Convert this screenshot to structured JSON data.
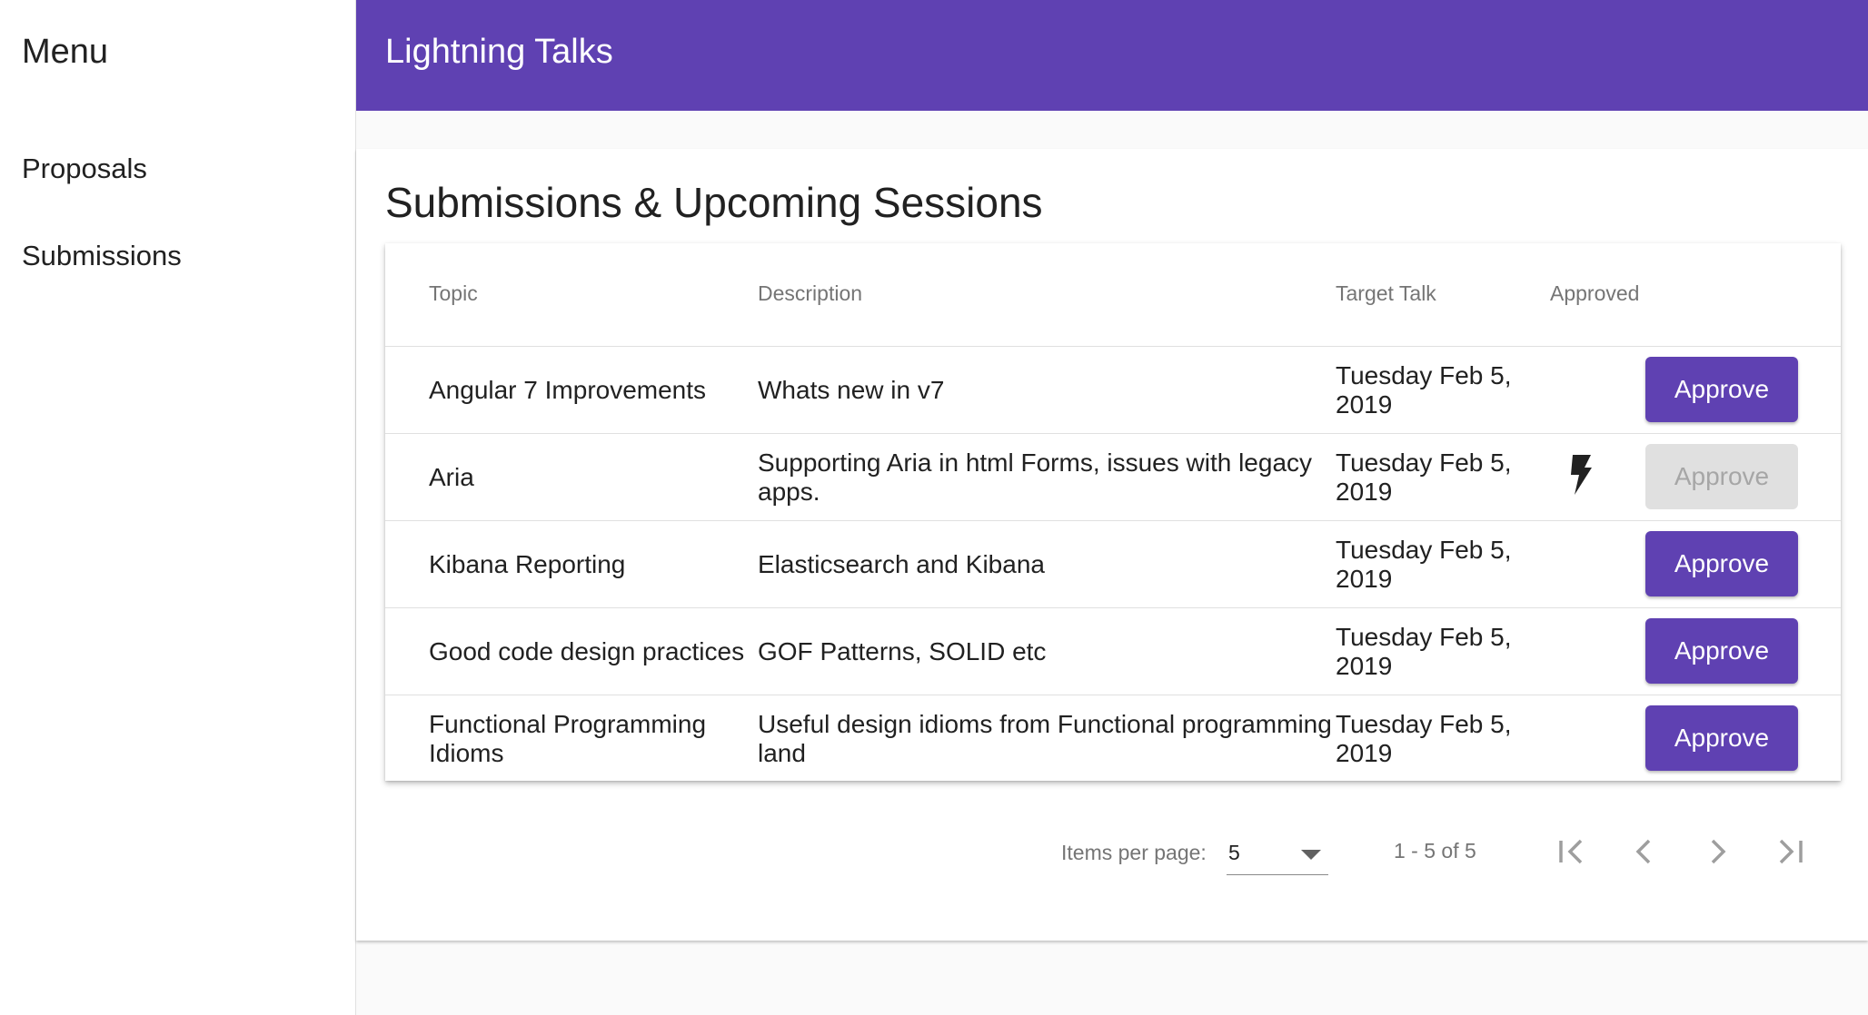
{
  "sidebar": {
    "title": "Menu",
    "items": [
      {
        "label": "Proposals"
      },
      {
        "label": "Submissions"
      }
    ]
  },
  "toolbar": {
    "title": "Lightning Talks"
  },
  "colors": {
    "primary": "#5f41b2",
    "disabled_bg": "#e0e0e0",
    "disabled_text": "#a6a6a6"
  },
  "main": {
    "title": "Submissions & Upcoming Sessions",
    "table": {
      "headers": {
        "topic": "Topic",
        "description": "Description",
        "target": "Target Talk",
        "approved": "Approved"
      },
      "rows": [
        {
          "topic": "Angular 7 Improvements",
          "description": "Whats new in v7",
          "target": "Tuesday Feb 5, 2019",
          "approved": false,
          "action": "Approve",
          "action_disabled": false
        },
        {
          "topic": "Aria",
          "description": "Supporting Aria in html Forms, issues with legacy apps.",
          "target": "Tuesday Feb 5, 2019",
          "approved": true,
          "approved_icon": "lightning-bolt-icon",
          "action": "Approve",
          "action_disabled": true
        },
        {
          "topic": "Kibana Reporting",
          "description": "Elasticsearch and Kibana",
          "target": "Tuesday Feb 5, 2019",
          "approved": false,
          "action": "Approve",
          "action_disabled": false
        },
        {
          "topic": "Good code design practices",
          "description": "GOF Patterns, SOLID etc",
          "target": "Tuesday Feb 5, 2019",
          "approved": false,
          "action": "Approve",
          "action_disabled": false
        },
        {
          "topic": "Functional Programming Idioms",
          "description": "Useful design idioms from Functional programming land",
          "target": "Tuesday Feb 5, 2019",
          "approved": false,
          "action": "Approve",
          "action_disabled": false
        }
      ]
    },
    "paginator": {
      "items_per_page_label": "Items per page:",
      "page_size": "5",
      "range_label": "1 - 5 of 5",
      "icons": {
        "first": "first-page-icon",
        "prev": "chevron-left-icon",
        "next": "chevron-right-icon",
        "last": "last-page-icon"
      }
    }
  }
}
